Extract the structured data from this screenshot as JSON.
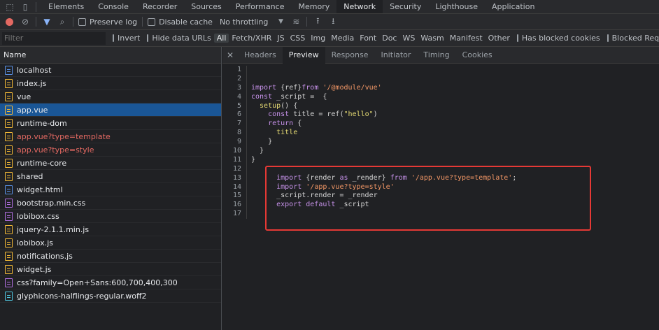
{
  "panel_tabs": [
    "Elements",
    "Console",
    "Recorder",
    "Sources",
    "Performance",
    "Memory",
    "Network",
    "Security",
    "Lighthouse",
    "Application"
  ],
  "active_panel": "Network",
  "toolbar": {
    "preserve_log": "Preserve log",
    "disable_cache": "Disable cache",
    "throttling": "No throttling"
  },
  "filterbar": {
    "placeholder": "Filter",
    "invert": "Invert",
    "hide_data_urls": "Hide data URLs",
    "types": [
      "All",
      "Fetch/XHR",
      "JS",
      "CSS",
      "Img",
      "Media",
      "Font",
      "Doc",
      "WS",
      "Wasm",
      "Manifest",
      "Other"
    ],
    "has_blocked_cookies": "Has blocked cookies",
    "blocked_requests": "Blocked Requests"
  },
  "requests_header": "Name",
  "requests": [
    {
      "name": "localhost",
      "type": "doc",
      "selected": false,
      "error": false
    },
    {
      "name": "index.js",
      "type": "js",
      "selected": false,
      "error": false
    },
    {
      "name": "vue",
      "type": "js",
      "selected": false,
      "error": false
    },
    {
      "name": "app.vue",
      "type": "js",
      "selected": true,
      "error": false
    },
    {
      "name": "runtime-dom",
      "type": "js",
      "selected": false,
      "error": false
    },
    {
      "name": "app.vue?type=template",
      "type": "js",
      "selected": false,
      "error": true
    },
    {
      "name": "app.vue?type=style",
      "type": "js",
      "selected": false,
      "error": true
    },
    {
      "name": "runtime-core",
      "type": "js",
      "selected": false,
      "error": false
    },
    {
      "name": "shared",
      "type": "js",
      "selected": false,
      "error": false
    },
    {
      "name": "widget.html",
      "type": "doc",
      "selected": false,
      "error": false
    },
    {
      "name": "bootstrap.min.css",
      "type": "css",
      "selected": false,
      "error": false
    },
    {
      "name": "lobibox.css",
      "type": "css",
      "selected": false,
      "error": false
    },
    {
      "name": "jquery-2.1.1.min.js",
      "type": "js",
      "selected": false,
      "error": false
    },
    {
      "name": "lobibox.js",
      "type": "js",
      "selected": false,
      "error": false
    },
    {
      "name": "notifications.js",
      "type": "js",
      "selected": false,
      "error": false
    },
    {
      "name": "widget.js",
      "type": "js",
      "selected": false,
      "error": false
    },
    {
      "name": "css?family=Open+Sans:600,700,400,300",
      "type": "css",
      "selected": false,
      "error": false
    },
    {
      "name": "glyphicons-halflings-regular.woff2",
      "type": "font",
      "selected": false,
      "error": false
    }
  ],
  "detail_tabs": [
    "Headers",
    "Preview",
    "Response",
    "Initiator",
    "Timing",
    "Cookies"
  ],
  "active_detail_tab": "Preview",
  "code_lines": [
    {
      "n": "1",
      "segs": []
    },
    {
      "n": "2",
      "segs": []
    },
    {
      "n": "3",
      "segs": [
        [
          "kw",
          "import "
        ],
        [
          "txt",
          "{ref}"
        ],
        [
          "kw",
          "from "
        ],
        [
          "str2",
          "'/@module/vue'"
        ]
      ]
    },
    {
      "n": "4",
      "segs": [
        [
          "kw",
          "const "
        ],
        [
          "txt",
          "_script =  {"
        ]
      ]
    },
    {
      "n": "5",
      "segs": [
        [
          "fn",
          "  setup"
        ],
        [
          "txt",
          "() {"
        ]
      ]
    },
    {
      "n": "6",
      "segs": [
        [
          "kw",
          "    const "
        ],
        [
          "txt",
          "title = ref("
        ],
        [
          "str",
          "\"hello\""
        ],
        [
          "txt",
          ")"
        ]
      ]
    },
    {
      "n": "7",
      "segs": [
        [
          "kw",
          "    return "
        ],
        [
          "txt",
          "{"
        ]
      ]
    },
    {
      "n": "8",
      "segs": [
        [
          "fn",
          "      title"
        ]
      ]
    },
    {
      "n": "9",
      "segs": [
        [
          "txt",
          "    }"
        ]
      ]
    },
    {
      "n": "10",
      "segs": [
        [
          "txt",
          "  }"
        ]
      ]
    },
    {
      "n": "11",
      "segs": [
        [
          "txt",
          "}"
        ]
      ]
    },
    {
      "n": "12",
      "segs": []
    },
    {
      "n": "13",
      "segs": [
        [
          "kw",
          "      import "
        ],
        [
          "txt",
          "{render "
        ],
        [
          "kw",
          "as "
        ],
        [
          "txt",
          "_render} "
        ],
        [
          "kw",
          "from "
        ],
        [
          "str2",
          "'/app.vue?type=template'"
        ],
        [
          "txt",
          ";"
        ]
      ]
    },
    {
      "n": "14",
      "segs": [
        [
          "kw",
          "      import "
        ],
        [
          "str2",
          "'/app.vue?type=style'"
        ]
      ]
    },
    {
      "n": "15",
      "segs": [
        [
          "txt",
          "      _script.render = _render"
        ]
      ]
    },
    {
      "n": "16",
      "segs": [
        [
          "kw",
          "      export default "
        ],
        [
          "txt",
          "_script"
        ]
      ]
    },
    {
      "n": "17",
      "segs": []
    }
  ],
  "colors": {
    "error": "#e46962",
    "selected": "#1a5696",
    "highlight_box": "#e53935",
    "active_tab": "#202124"
  }
}
